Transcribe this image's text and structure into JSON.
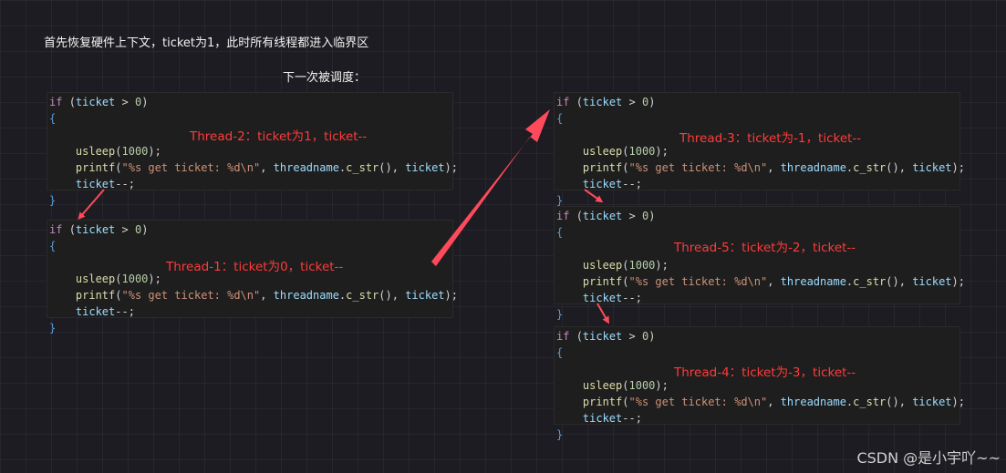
{
  "captions": {
    "top": "首先恢复硬件上下文，ticket为1，此时所有线程都进入临界区",
    "sub": "下一次被调度："
  },
  "code": {
    "if_kw": "if",
    "cond_open": "(",
    "cond_var": "ticket",
    "cond_op": " > ",
    "cond_num": "0",
    "cond_close": ")",
    "brace_open": "{",
    "brace_close": "}",
    "usleep_fn": "usleep",
    "usleep_arg": "1000",
    "printf_fn": "printf",
    "printf_str": "\"%s get ticket: %d\\n\"",
    "printf_arg1": "threadname",
    "printf_fn2": "c_str",
    "printf_arg2": "ticket",
    "dec_var": "ticket",
    "dec_op": "--;"
  },
  "annotations": {
    "t2": "Thread-2：ticket为1，ticket--",
    "t1": "Thread-1：ticket为0，ticket--",
    "t3": "Thread-3：ticket为-1，ticket--",
    "t5": "Thread-5：ticket为-2，ticket--",
    "t4": "Thread-4：ticket为-3，ticket--"
  },
  "colors": {
    "annotation": "#ff3b3b",
    "arrow": "#ff4a5c",
    "background": "#1d1c22",
    "code_bg": "#1e1e1e"
  },
  "watermark": "CSDN @是小宇吖~~"
}
